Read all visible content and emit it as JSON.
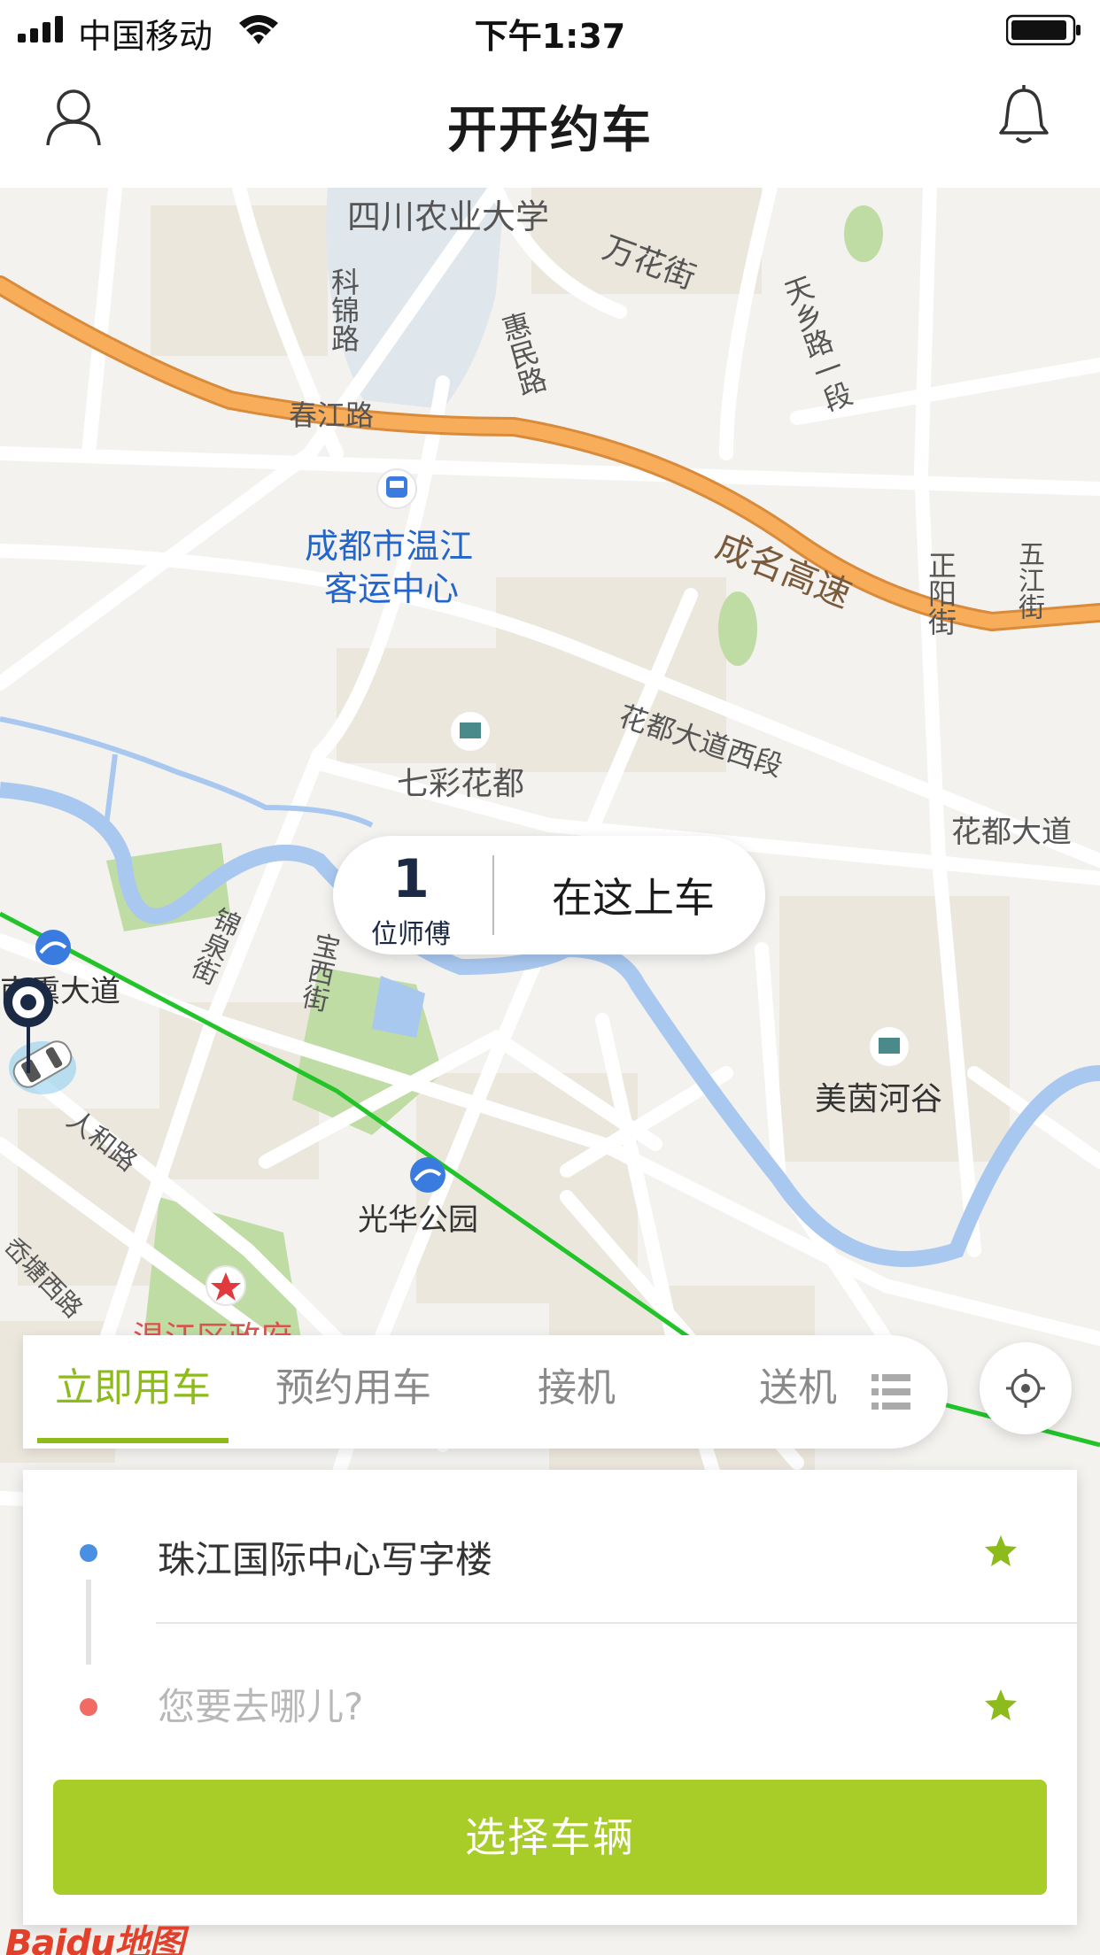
{
  "status_bar": {
    "carrier": "中国移动",
    "time": "下午1:37"
  },
  "header": {
    "title": "开开约车"
  },
  "map": {
    "labels": {
      "sichuan_agri_univ": "四川农业大学",
      "wanhua_st": "万花街",
      "kejin_rd": "科锦路",
      "huimin_rd": "惠民路",
      "tianxiang_rd": "天乡路一段",
      "chunjiang_rd": "春江路",
      "bus_station_line1": "成都市温江",
      "bus_station_line2": "客运中心",
      "chengming_expwy": "成名高速",
      "zhengyang_st": "正阳街",
      "wujiang_st": "五江街",
      "qicai_huadu": "七彩花都",
      "huadu_west": "花都大道西段",
      "huadu_ave": "花都大道",
      "jinquan_st": "锦泉街",
      "baoxi_st": "宝西街",
      "nanxun_ave": "南熏大道",
      "meiyin_valley": "美茵河谷",
      "renhe_rd": "人和路",
      "guanghua_park": "光华公园",
      "shuntang_rd": "岙塘西路",
      "wenjiang_gov": "温江区政府"
    },
    "pickup": {
      "driver_count": "1",
      "driver_label": "位师傅",
      "action": "在这上车"
    },
    "logo": "Baidu地图"
  },
  "tabs": [
    {
      "label": "立即用车",
      "active": true
    },
    {
      "label": "预约用车",
      "active": false
    },
    {
      "label": "接机",
      "active": false
    },
    {
      "label": "送机",
      "active": false
    }
  ],
  "trip": {
    "start": "珠江国际中心写字楼",
    "destination_placeholder": "您要去哪儿?",
    "select_button": "选择车辆"
  },
  "colors": {
    "accent": "#8dbb1c",
    "button": "#a8cc28",
    "start_dot": "#4a90e2",
    "end_dot": "#f16a64",
    "expressway": "#f0a050",
    "metro_line": "#22c42a",
    "river": "#a8c8f0"
  }
}
